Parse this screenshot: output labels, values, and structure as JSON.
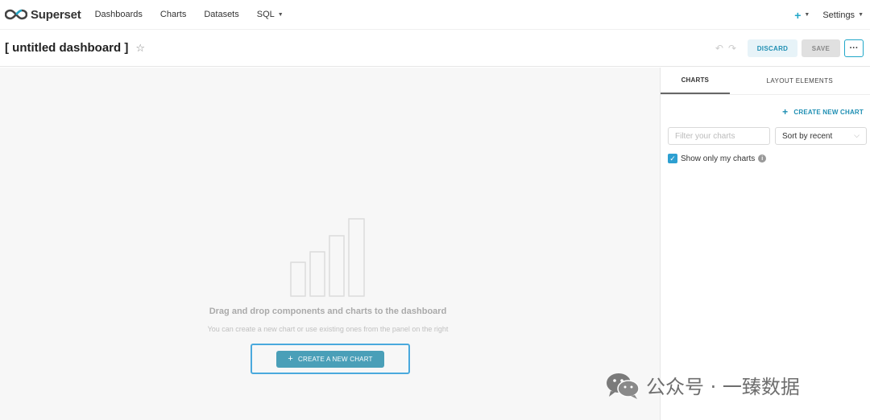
{
  "app": {
    "name": "Superset",
    "nav": [
      "Dashboards",
      "Charts",
      "Datasets",
      "SQL"
    ],
    "plus_label": "+",
    "settings_label": "Settings"
  },
  "header": {
    "title": "[ untitled dashboard ]",
    "discard_label": "DISCARD",
    "save_label": "SAVE",
    "more_label": "···"
  },
  "canvas": {
    "empty_title": "Drag and drop components and charts to the dashboard",
    "empty_subtitle": "You can create a new chart or use existing ones from the panel on the right",
    "create_button": "CREATE A NEW CHART"
  },
  "panel": {
    "tabs": [
      "CHARTS",
      "LAYOUT ELEMENTS"
    ],
    "create_new": "CREATE NEW CHART",
    "filter_placeholder": "Filter your charts",
    "sort_value": "Sort by recent",
    "show_only_mine": "Show only my charts"
  },
  "watermark": {
    "text": "公众号 · 一臻数据"
  },
  "colors": {
    "accent": "#20a7c9",
    "cta": "#4a9fb8",
    "checkbox": "#2d9fd1"
  }
}
